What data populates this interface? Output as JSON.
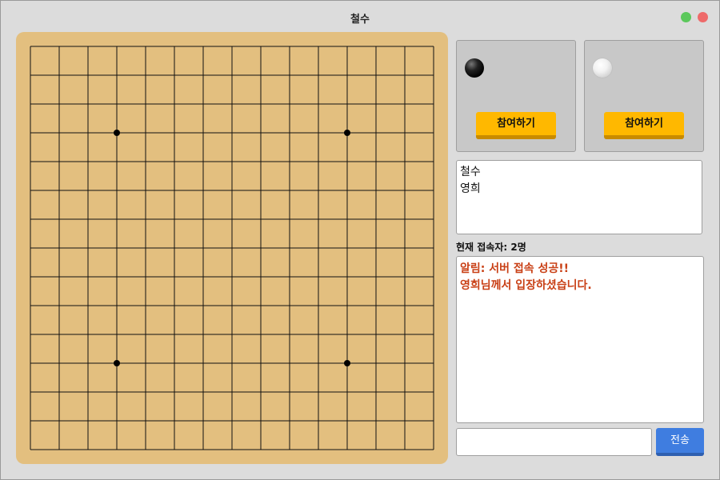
{
  "window": {
    "title": "철수"
  },
  "board": {
    "lines": 15,
    "star_points": [
      [
        3,
        3
      ],
      [
        11,
        3
      ],
      [
        3,
        11
      ],
      [
        11,
        11
      ]
    ],
    "background_color": "#e3bf7f"
  },
  "players": {
    "black": {
      "stone": "black-stone",
      "join_label": "참여하기"
    },
    "white": {
      "stone": "white-stone",
      "join_label": "참여하기"
    }
  },
  "user_list": [
    "철수",
    "영희"
  ],
  "connection_count": "현재 접속자: 2명",
  "chat": {
    "messages": [
      "알림: 서버 접속 성공!!",
      "영희님께서 입장하셨습니다."
    ],
    "message_color": "#c94016",
    "input_value": "",
    "input_placeholder": "",
    "send_label": "전송"
  },
  "colors": {
    "join_button": "#ffb800",
    "send_button": "#3f7de0",
    "close_dot": "#ee6a6a",
    "maximize_dot": "#5cc85c"
  }
}
